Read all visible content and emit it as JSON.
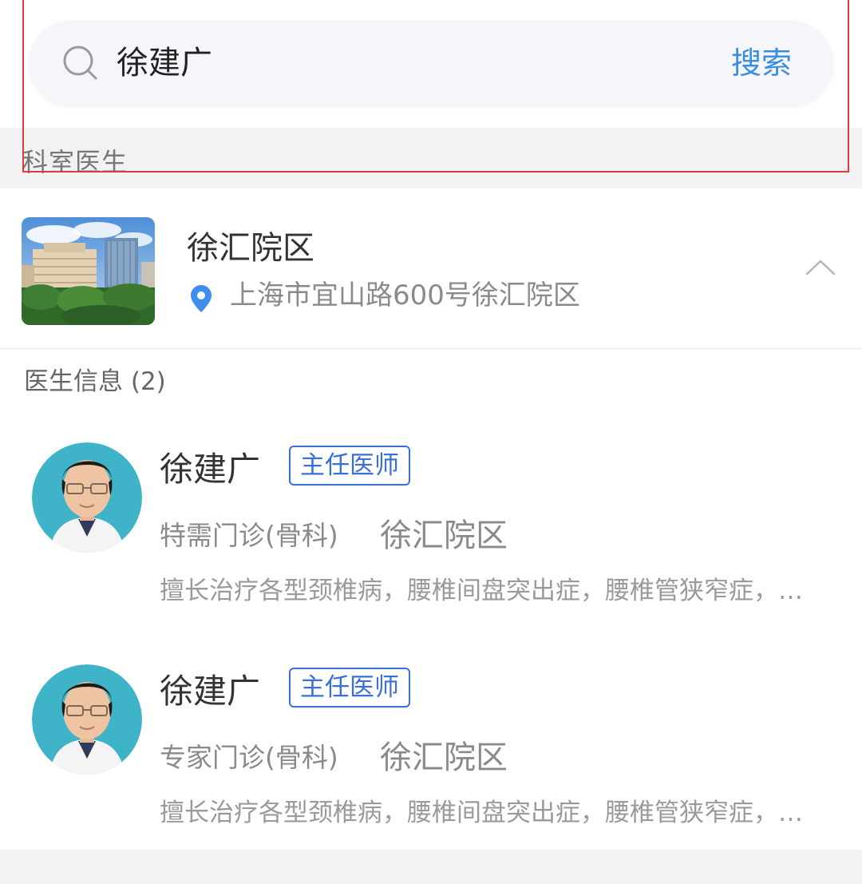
{
  "search": {
    "query": "徐建广",
    "button_label": "搜索"
  },
  "section": {
    "title": "科室医生"
  },
  "campus": {
    "name": "徐汇院区",
    "address": "上海市宜山路600号徐汇院区",
    "photo": "hospital-building-photo"
  },
  "doctor_list": {
    "header": "医生信息 (2)"
  },
  "doctors": [
    {
      "name": "徐建广",
      "title": "主任医师",
      "clinic": "特需门诊(骨科)",
      "campus": "徐汇院区",
      "specialty": "擅长治疗各型颈椎病，腰椎间盘突出症，腰椎管狭窄症，…"
    },
    {
      "name": "徐建广",
      "title": "主任医师",
      "clinic": "专家门诊(骨科)",
      "campus": "徐汇院区",
      "specialty": "擅长治疗各型颈椎病，腰椎间盘突出症，腰椎管狭窄症，…"
    }
  ],
  "colors": {
    "accent": "#3b8de0",
    "badge": "#3a6fd6",
    "highlight": "#e03a3a",
    "pin": "#3d8ef0"
  },
  "icons": [
    "search-icon",
    "location-pin-icon",
    "chevron-up-icon"
  ]
}
